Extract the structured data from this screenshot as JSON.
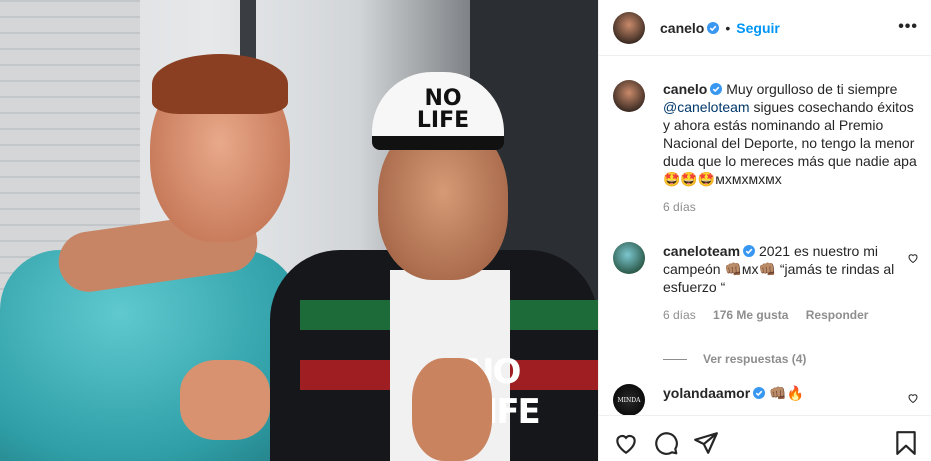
{
  "post_author": {
    "username": "canelo",
    "follow_label": "Seguir",
    "separator": "•"
  },
  "photo": {
    "cap_text": "NO LIFE",
    "shirt_text": "NO LIFE"
  },
  "caption": {
    "username": "canelo",
    "text_before": "Muy orgulloso de ti siempre",
    "mention": "@caneloteam",
    "text_after": "sigues cosechando éxitos y ahora estás nominando al Premio Nacional del Deporte, no tengo la menor duda que lo mereces más que nadie apa",
    "emoji_line": "🤩🤩🤩ᴍxᴍxᴍxᴍx",
    "time": "6 días"
  },
  "comments": [
    {
      "username": "caneloteam",
      "text": "2021 es nuestro mi campeón 👊🏽ᴍx👊🏽 “jamás te rindas al esfuerzo “",
      "time": "6 días",
      "likes": "176 Me gusta",
      "reply_label": "Responder",
      "view_replies": "Ver respuestas (4)"
    },
    {
      "username": "yolandaamor",
      "text": "👊🏽🔥",
      "avatar_text": "MINDA"
    }
  ],
  "icons": {
    "like": "heart-icon",
    "comment": "comment-icon",
    "share": "share-icon",
    "save": "bookmark-icon",
    "more": "more-options-icon",
    "verified": "verified-badge-icon"
  },
  "colors": {
    "link_blue": "#0095f6",
    "mention_blue": "#00376b",
    "verified_blue": "#3897f0",
    "muted_text": "#8e8e8e"
  }
}
